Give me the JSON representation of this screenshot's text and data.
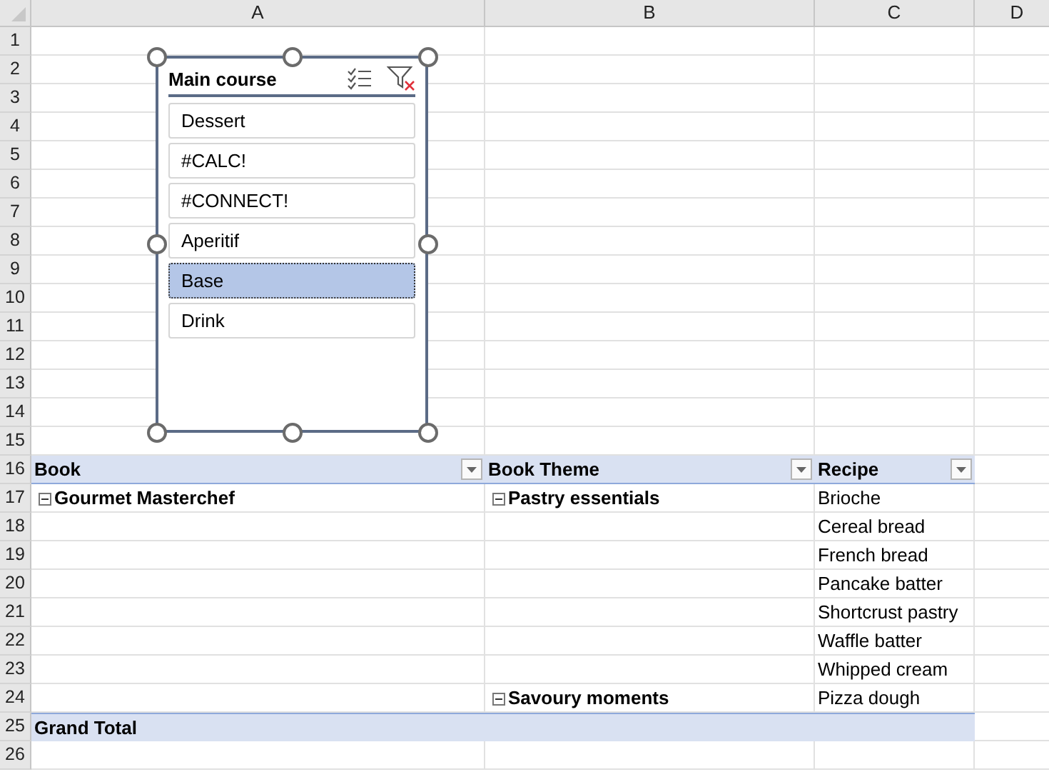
{
  "columns": [
    "A",
    "B",
    "C",
    "D"
  ],
  "row_numbers": [
    "1",
    "2",
    "3",
    "4",
    "5",
    "6",
    "7",
    "8",
    "9",
    "10",
    "11",
    "12",
    "13",
    "14",
    "15",
    "16",
    "17",
    "18",
    "19",
    "20",
    "21",
    "22",
    "23",
    "24",
    "25",
    "26"
  ],
  "slicer": {
    "title": "Main course",
    "items": [
      {
        "label": "Dessert",
        "selected": false
      },
      {
        "label": "#CALC!",
        "selected": false
      },
      {
        "label": "#CONNECT!",
        "selected": false
      },
      {
        "label": "Aperitif",
        "selected": false
      },
      {
        "label": "Base",
        "selected": true
      },
      {
        "label": "Drink",
        "selected": false
      }
    ]
  },
  "pivot": {
    "headers": [
      "Book",
      "Book Theme",
      "Recipe"
    ],
    "books": [
      {
        "label": "Gourmet Masterchef",
        "expanded": true,
        "themes": [
          {
            "label": "Pastry essentials",
            "expanded": true,
            "recipes": [
              "Brioche",
              "Cereal bread",
              "French bread",
              "Pancake batter",
              "Shortcrust pastry",
              "Waffle batter",
              "Whipped cream"
            ]
          },
          {
            "label": "Savoury moments",
            "expanded": true,
            "recipes": [
              "Pizza dough"
            ]
          }
        ]
      }
    ],
    "grand_total": "Grand Total"
  }
}
